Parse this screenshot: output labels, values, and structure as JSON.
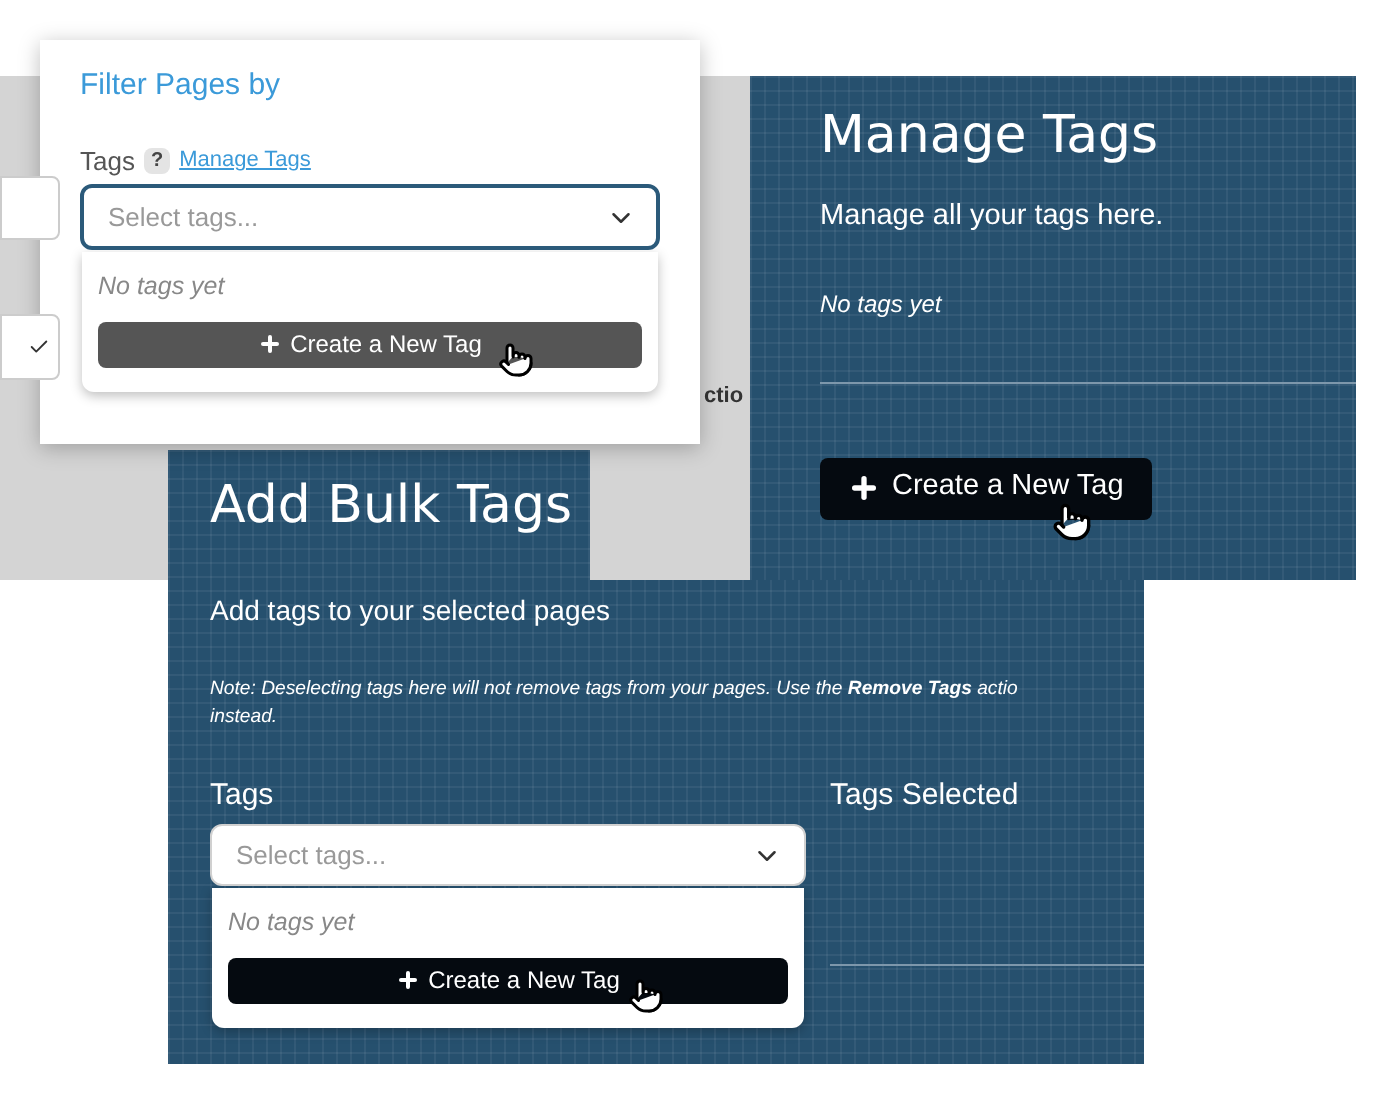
{
  "background_page": {
    "fragment": "ctio"
  },
  "manage_tags_panel": {
    "title": "Manage Tags",
    "description": "Manage all your tags here.",
    "empty_text": "No tags yet",
    "button": "Create a New Tag"
  },
  "filter_panel": {
    "title": "Filter Pages by",
    "field_label": "Tags",
    "help_badge": "?",
    "link": "Manage Tags",
    "select": {
      "placeholder": "Select tags...",
      "focused": true,
      "open": true
    },
    "dropdown": {
      "empty_text": "No tags yet",
      "button": "Create a New Tag"
    }
  },
  "bulk_panel": {
    "title": "Add Bulk Tags",
    "description": "Add tags to your selected pages",
    "note_lines": [
      "Note: Deselecting tags here will not remove tags from your pages. Use the **Remove Tags** actio",
      "instead."
    ],
    "field_label": "Tags",
    "selected_label": "Tags Selected",
    "select": {
      "placeholder": "Select tags...",
      "focused": false,
      "open": true
    },
    "dropdown": {
      "empty_text": "No tags yet",
      "button": "Create a New Tag"
    }
  }
}
